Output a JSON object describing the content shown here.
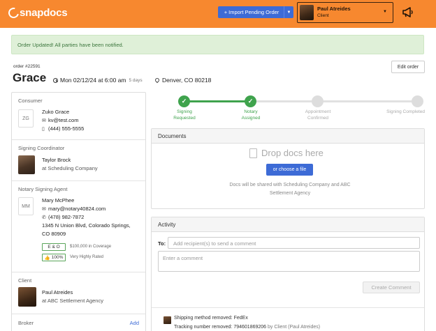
{
  "header": {
    "logo_text": "snapdocs",
    "import_label": "+ Import Pending Order",
    "user": {
      "name": "Paul Atreides",
      "role": "Client"
    },
    "colors": {
      "bar": "#f7882f",
      "primary": "#3d6bd6",
      "success": "#3fa34d"
    }
  },
  "alert": {
    "message": "Order Updated! All parties have been notified."
  },
  "order": {
    "number": "order #22591",
    "title": "Grace",
    "datetime": "Mon 02/12/24 at 6:00 am",
    "days": "5 days",
    "location": "Denver, CO 80218",
    "edit_label": "Edit order"
  },
  "consumer": {
    "title": "Consumer",
    "initials": "ZG",
    "name": "Zuko Grace",
    "email": "kv@test.com",
    "phone": "(444) 555-5555"
  },
  "coordinator": {
    "title": "Signing Coordinator",
    "name": "Taylor Brock",
    "company": "at Scheduling Company"
  },
  "agent": {
    "title": "Notary Signing Agent",
    "initials": "MM",
    "name": "Mary McPhee",
    "email": "mary@notary40824.com",
    "phone": "(478) 982-7872",
    "address1": "1345 N Union Blvd, Colorado Springs,",
    "address2": "CO 80909",
    "eo_label": "E & O",
    "eo_note": "$100,000 in Coverage",
    "rating_label": "100%",
    "rating_note": "Very Highly Rated"
  },
  "client": {
    "title": "Client",
    "name": "Paul Atreides",
    "company": "at ABC Settlement Agency"
  },
  "broker": {
    "title": "Broker",
    "add_label": "Add"
  },
  "progress": {
    "steps": [
      {
        "line1": "Signing",
        "line2": "Requested",
        "done": true
      },
      {
        "line1": "Notary",
        "line2": "Assigned",
        "done": true
      },
      {
        "line1": "Appointment",
        "line2": "Confirmed",
        "done": false
      },
      {
        "line1": "Signing Completed",
        "line2": "",
        "done": false
      }
    ]
  },
  "documents": {
    "title": "Documents",
    "drop_text": "Drop docs here",
    "choose_label": "or choose a file",
    "share_note": "Docs will be shared with Scheduling Company and ABC Settlement Agency"
  },
  "activity": {
    "title": "Activity",
    "to_label": "To:",
    "to_placeholder": "Add recipient(s) to send a comment",
    "comment_placeholder": "Enter a comment",
    "create_label": "Create Comment",
    "log": {
      "line1": "Shipping method removed: FedEx",
      "line2": "Tracking number removed: 794601869206",
      "by": "by Client (Paul Atreides)"
    }
  }
}
